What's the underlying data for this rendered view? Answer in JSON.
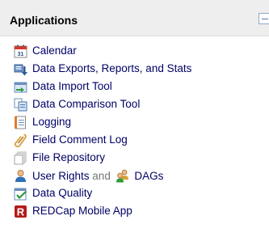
{
  "panel": {
    "title": "Applications",
    "collapse_icon": "minus-box-icon"
  },
  "colors": {
    "header_bg": "#eeeeee",
    "link": "#000066",
    "muted": "#777777"
  },
  "items": [
    {
      "label": "Calendar",
      "icon": "calendar-icon"
    },
    {
      "label": "Data Exports, Reports, and Stats",
      "icon": "data-export-icon"
    },
    {
      "label": "Data Import Tool",
      "icon": "data-import-icon"
    },
    {
      "label": "Data Comparison Tool",
      "icon": "data-comparison-icon"
    },
    {
      "label": "Logging",
      "icon": "logging-icon"
    },
    {
      "label": "Field Comment Log",
      "icon": "field-comment-icon"
    },
    {
      "label": "File Repository",
      "icon": "file-repository-icon"
    },
    {
      "label": "User Rights",
      "connector": "and",
      "label2": "DAGs",
      "icon": "user-icon",
      "icon2": "group-icon"
    },
    {
      "label": "Data Quality",
      "icon": "data-quality-icon"
    },
    {
      "label": "REDCap Mobile App",
      "icon": "mobile-app-icon"
    }
  ]
}
